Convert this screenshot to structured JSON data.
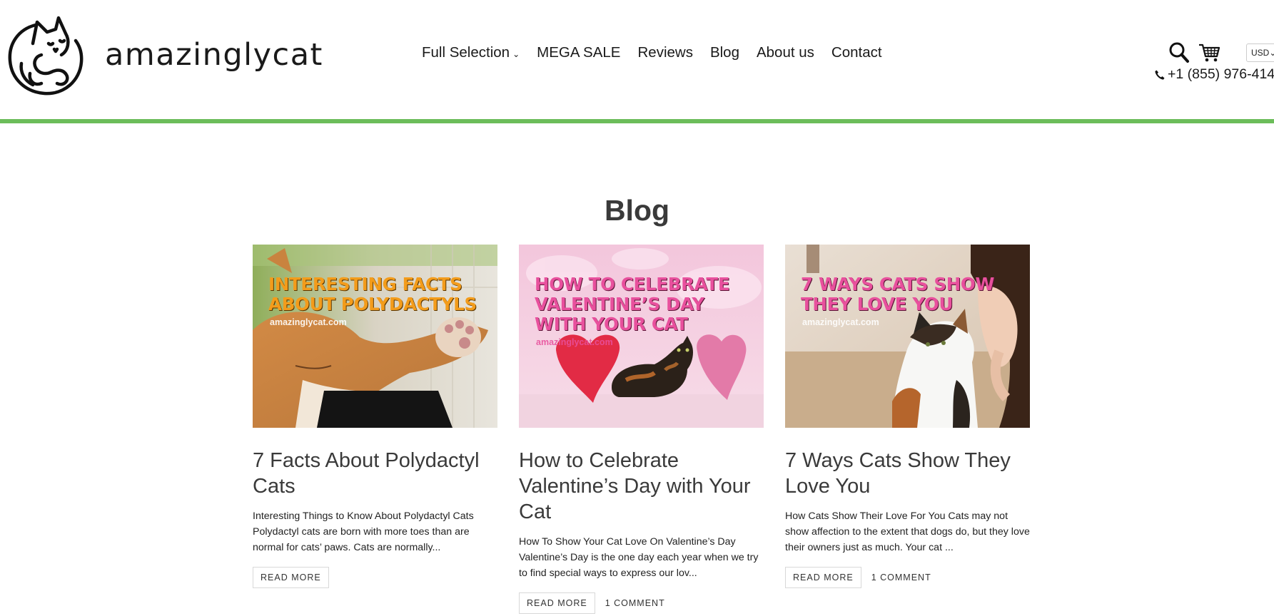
{
  "header": {
    "logo_text": "amazinglycat",
    "nav": [
      {
        "label": "Full Selection",
        "has_dropdown": true
      },
      {
        "label": "MEGA SALE"
      },
      {
        "label": "Reviews"
      },
      {
        "label": "Blog"
      },
      {
        "label": "About us"
      },
      {
        "label": "Contact"
      }
    ],
    "currency": "USD",
    "phone": "+1 (855) 976-414",
    "icons": [
      "search-icon",
      "cart-icon",
      "phone-icon",
      "chevron-down-icon"
    ],
    "accent_color": "#6cbd5a"
  },
  "blog": {
    "title": "Blog",
    "posts": [
      {
        "image_headline": "INTERESTING FACTS ABOUT POLYDACTYLS",
        "image_site": "amazinglycat.com",
        "title": "7 Facts About Polydactyl Cats",
        "excerpt": "Interesting Things to Know About Polydactyl Cats Polydactyl cats are born with more toes than are normal for cats’ paws. Cats are normally...",
        "read_more": "READ MORE",
        "comments": ""
      },
      {
        "image_headline": "HOW TO CELEBRATE VALENTINE’S DAY WITH YOUR CAT",
        "image_site": "amazinglycat.com",
        "title": "How to Celebrate Valentine’s Day with Your Cat",
        "excerpt": " How To Show Your Cat Love On Valentine’s Day Valentine’s Day is the one day each year when we try to find special ways to express our lov...",
        "read_more": "READ MORE",
        "comments": "1 COMMENT"
      },
      {
        "image_headline": "7 WAYS CATS SHOW THEY LOVE YOU",
        "image_site": "amazinglycat.com",
        "title": "7 Ways Cats Show They Love You",
        "excerpt": "How Cats Show Their Love For You Cats may not show affection to the extent that dogs do, but they love their owners just as much. Your cat ...",
        "read_more": "READ MORE",
        "comments": "1 COMMENT"
      }
    ]
  }
}
